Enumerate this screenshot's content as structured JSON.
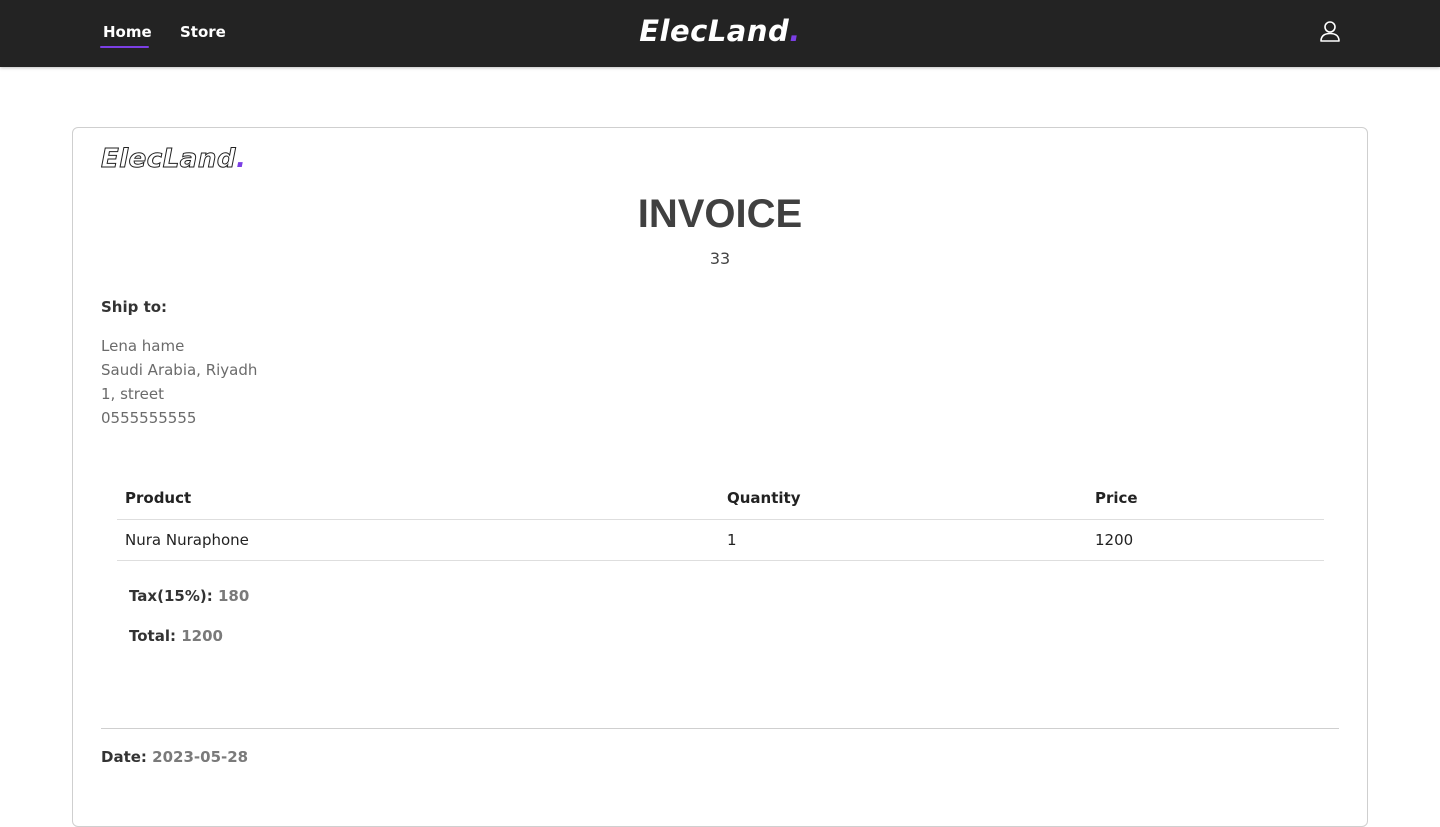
{
  "nav": {
    "links": [
      {
        "label": "Home",
        "active": true
      },
      {
        "label": "Store",
        "active": false
      }
    ],
    "brand": "ElecLand",
    "brand_dot": ".",
    "user_icon": "user-icon",
    "accent_color": "#7b3fe4",
    "bar_color": "#232323"
  },
  "invoice": {
    "logo_text": "ElecLand",
    "logo_dot": ".",
    "title": "INVOICE",
    "number": "33",
    "ship_to_label": "Ship to:",
    "ship_to": {
      "name": "Lena hame",
      "region": "Saudi Arabia, Riyadh",
      "street": "1, street",
      "phone": "0555555555"
    },
    "table": {
      "headers": [
        "Product",
        "Quantity",
        "Price"
      ],
      "rows": [
        [
          "Nura Nuraphone",
          "1",
          "1200"
        ]
      ]
    },
    "tax_label": "Tax(15%):",
    "tax_value": "180",
    "total_label": "Total:",
    "total_value": "1200",
    "date_label": "Date:",
    "date_value": "2023-05-28"
  }
}
